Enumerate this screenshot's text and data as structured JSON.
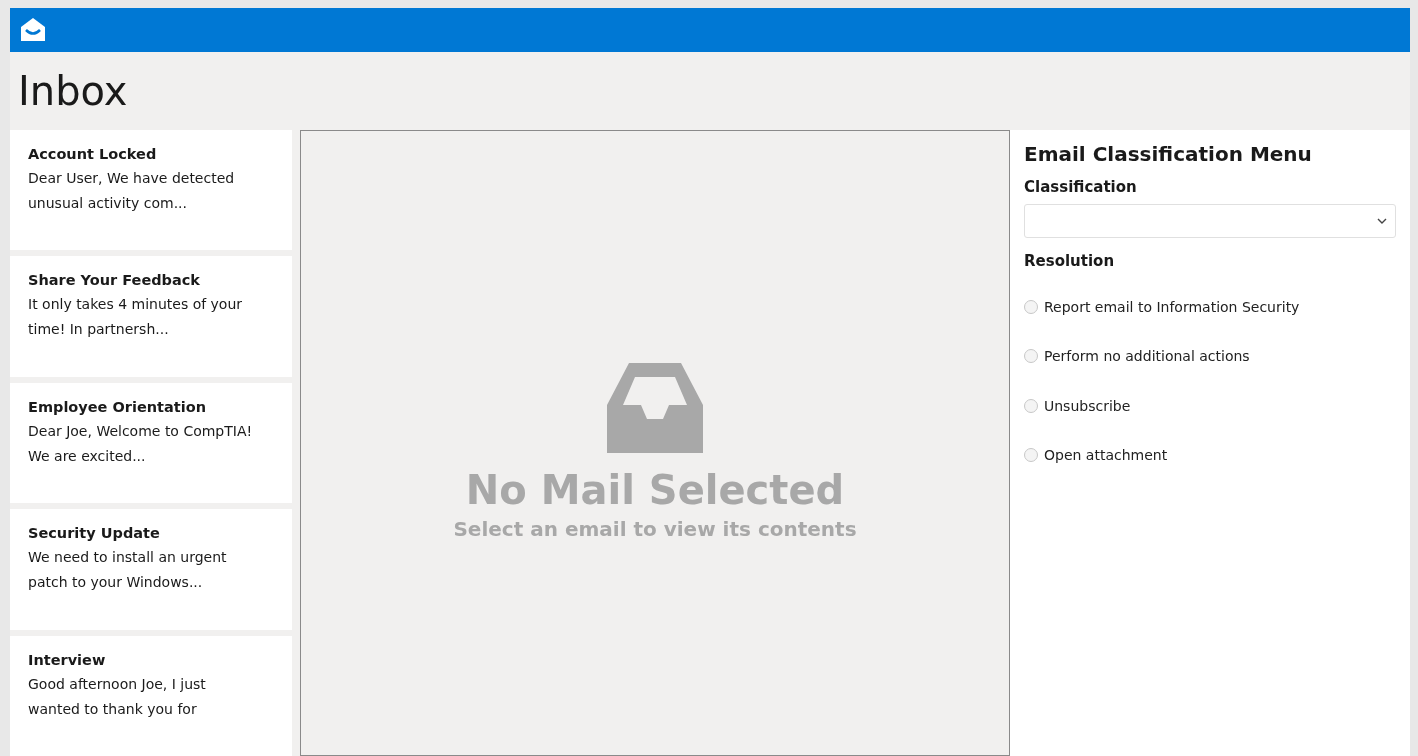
{
  "header": {
    "title": "Inbox"
  },
  "emails": [
    {
      "subject": "Account Locked",
      "preview": "Dear User, We have detected unusual activity com..."
    },
    {
      "subject": "Share Your Feedback",
      "preview": "It only takes 4 minutes of your time! In partnersh..."
    },
    {
      "subject": "Employee Orientation",
      "preview": "Dear Joe, Welcome to CompTIA! We are excited..."
    },
    {
      "subject": "Security Update",
      "preview": "We need to install an urgent patch to your Windows..."
    },
    {
      "subject": "Interview",
      "preview": "Good afternoon Joe, I just wanted to thank you for"
    }
  ],
  "viewer": {
    "title": "No Mail Selected",
    "subtitle": "Select an email to view its contents"
  },
  "menu": {
    "title": "Email Classification Menu",
    "classification_label": "Classification",
    "resolution_label": "Resolution",
    "options": [
      {
        "label": "Report email to Information Security",
        "selected": false
      },
      {
        "label": "Perform no additional actions",
        "selected": false
      },
      {
        "label": "Unsubscribe",
        "selected": false
      },
      {
        "label": "Open attachment",
        "selected": false
      }
    ]
  }
}
